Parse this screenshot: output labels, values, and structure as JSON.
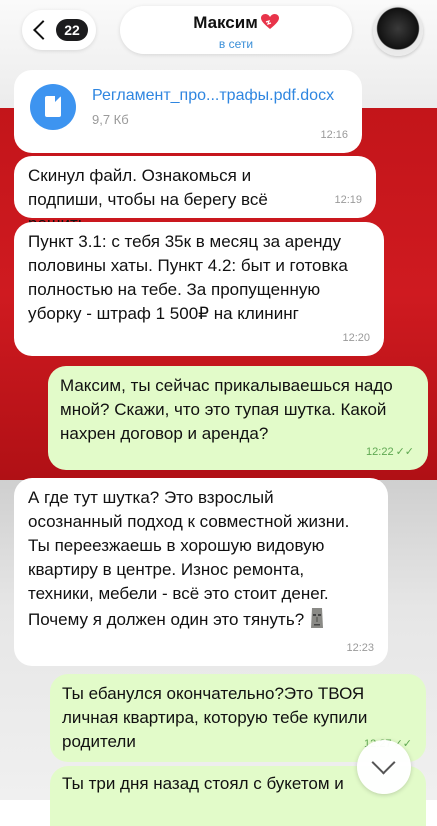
{
  "header": {
    "unread_count": "22",
    "contact_name": "Максим",
    "status": "в сети"
  },
  "messages": [
    {
      "type": "file",
      "direction": "in",
      "file_name": "Регламент_про...трафы.pdf.docx",
      "file_size": "9,7 Кб",
      "time": "12:16"
    },
    {
      "type": "text",
      "direction": "in",
      "text": "Скинул файл. Ознакомься и подпиши, чтобы на берегу всё решить",
      "time": "12:19"
    },
    {
      "type": "text",
      "direction": "in",
      "text": "Пункт 3.1: с тебя 35к в месяц за аренду половины хаты. Пункт 4.2: быт и готовка полностью на тебе. За пропущенную уборку - штраф 1 500₽ на клининг",
      "time": "12:20"
    },
    {
      "type": "text",
      "direction": "out",
      "text": "Максим, ты сейчас прикалываешься надо мной? Скажи, что это тупая шутка. Какой нахрен договор и аренда?",
      "time": "12:22"
    },
    {
      "type": "text",
      "direction": "in",
      "text": "А где тут шутка? Это взрослый осознанный подход к совместной жизни. Ты переезжаешь в хорошую видовую квартиру в центре. Износ ремонта, техники, мебели - всё это стоит денег. Почему я должен один это тянуть?",
      "time": "12:23"
    },
    {
      "type": "text",
      "direction": "out",
      "text": "Ты ебанулся окончательно?Это ТВОЯ личная квартира, которую тебе купили родители",
      "time": "12:27"
    },
    {
      "type": "text",
      "direction": "out",
      "text": "Ты три дня назад стоял с букетом и",
      "time": ""
    }
  ],
  "colors": {
    "incoming_bubble": "#ffffff",
    "outgoing_bubble": "#e2fbc9",
    "link_blue": "#2f86e0",
    "status_blue": "#3a8fd8",
    "read_ticks": "#5fa852"
  },
  "icons": {
    "back": "chevron-left-icon",
    "file": "document-icon",
    "heart": "heart-icon",
    "emoji": "moai-icon",
    "scroll": "chevron-down-icon"
  }
}
